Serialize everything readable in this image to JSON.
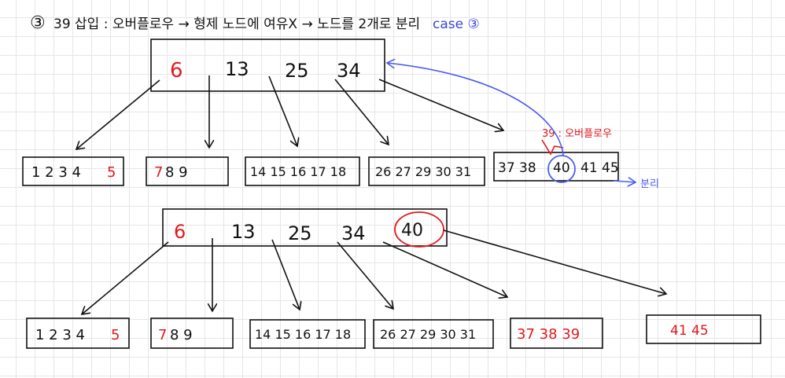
{
  "title": {
    "num": "③",
    "text": "39 삽입 : 오버플로우 → 형제 노드에 여유X → 노드를 2개로 분리",
    "case_label": "case ③"
  },
  "top_tree": {
    "root": [
      "6",
      "13",
      "25",
      "34"
    ],
    "leaves": [
      {
        "normal": "1 2 3 4",
        "red": "5"
      },
      {
        "red": "7",
        "normal": "8 9"
      },
      {
        "normal": "14 15 16 17 18"
      },
      {
        "normal": "26 27 29 30 31"
      },
      {
        "normal": "37 38",
        "circled": "40",
        "normal2": "41 45"
      }
    ],
    "overflow_note": "39 : 오버플로우",
    "split_note": "분리"
  },
  "bottom_tree": {
    "root": [
      "6",
      "13",
      "25",
      "34",
      "40"
    ],
    "leaves": [
      {
        "normal": "1 2 3 4",
        "red": "5"
      },
      {
        "red": "7",
        "normal": "8 9"
      },
      {
        "normal": "14 15 16 17 18"
      },
      {
        "normal": "26 27 29 30 31"
      },
      {
        "red": "37 38 39"
      },
      {
        "red": "41 45"
      }
    ]
  },
  "colors": {
    "ink": "#111111",
    "red": "#e0191e",
    "blue": "#4b5cf0"
  }
}
